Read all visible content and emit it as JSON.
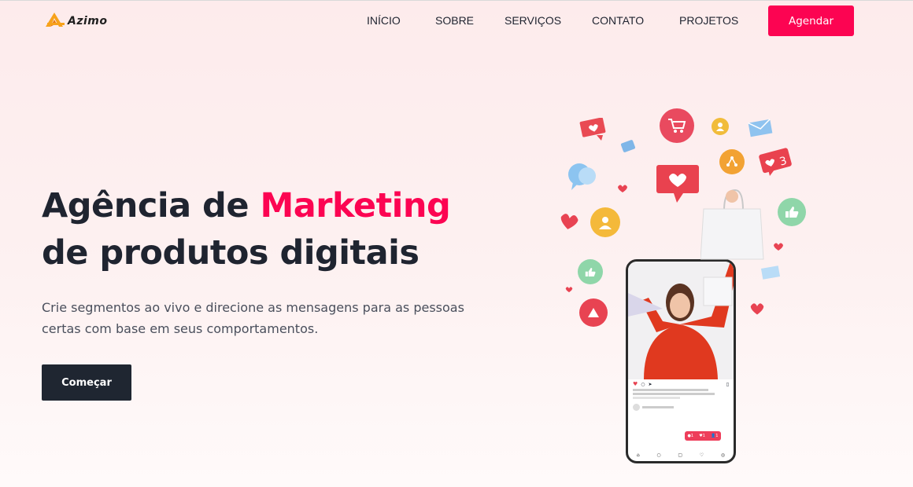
{
  "brand": {
    "name": "Azimo"
  },
  "nav": {
    "items": [
      "INÍCIO",
      "SOBRE",
      "SERVIÇOS",
      "CONTATO",
      "PROJETOS"
    ],
    "cta_label": "Agendar"
  },
  "hero": {
    "title_part1": "Agência de ",
    "title_accent": "Marketing",
    "title_line2": "de produtos digitais",
    "subtitle": "Crie segmentos ao vivo e direcione as mensagens para as pessoas certas com base em seus comportamentos.",
    "button_label": "Começar"
  },
  "colors": {
    "accent": "#fc0452",
    "dark": "#1f2631",
    "logo_orange": "#f7a21b"
  },
  "illustration": {
    "notification": {
      "comments": "1",
      "likes": "1",
      "followers": "1"
    }
  }
}
